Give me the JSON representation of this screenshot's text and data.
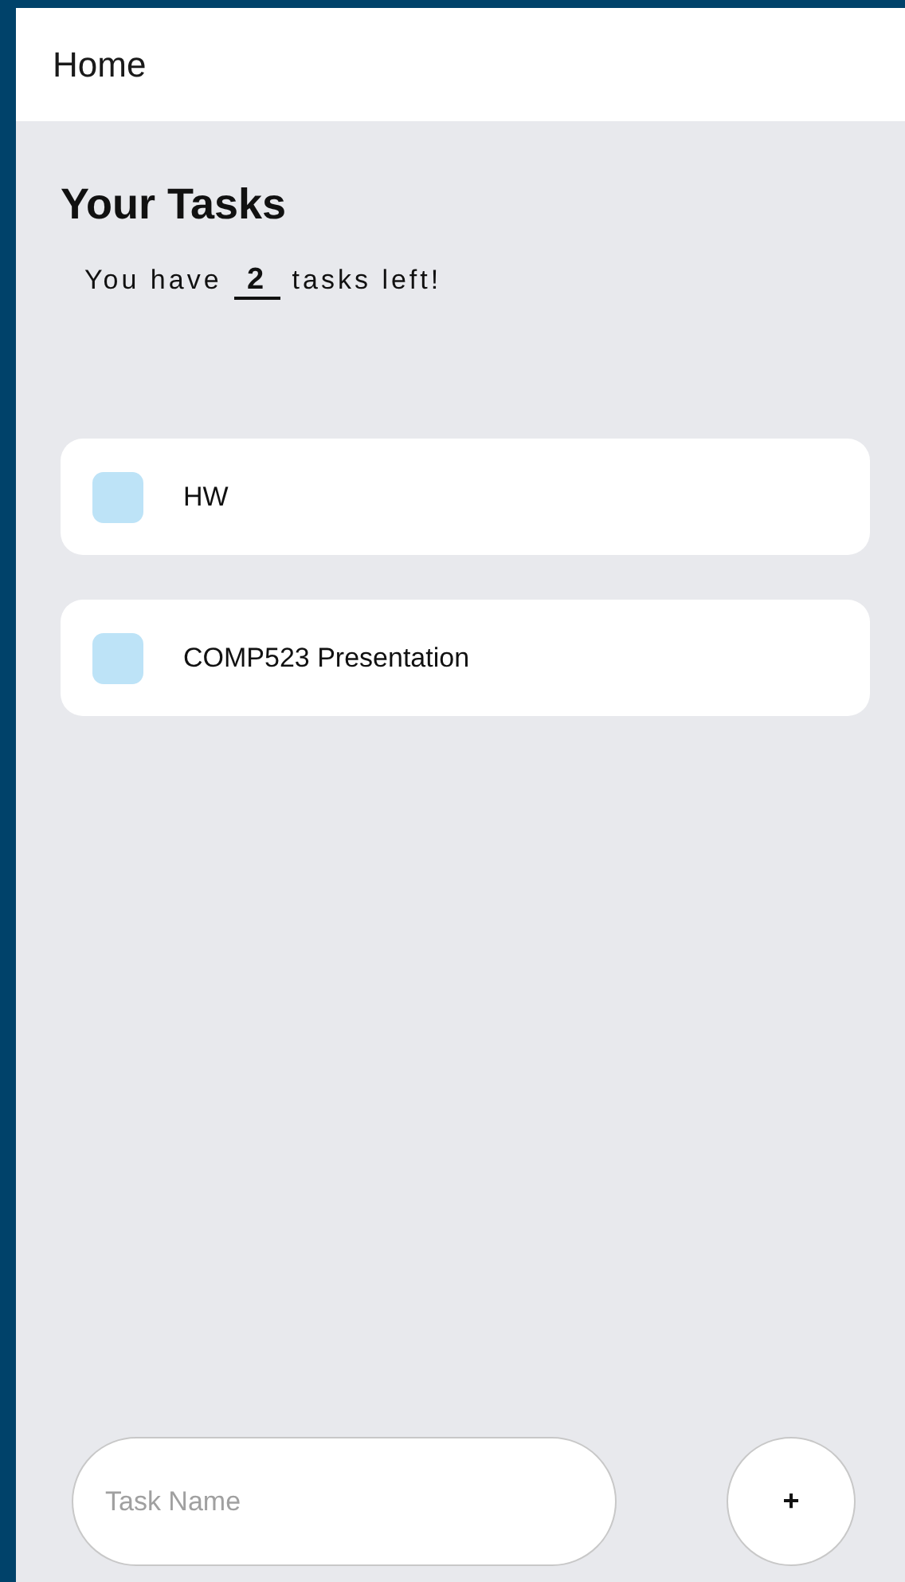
{
  "header": {
    "title": "Home"
  },
  "heading": "Your Tasks",
  "summary": "You have **2** tasks left!",
  "tasks": [
    {
      "label": "HW",
      "checked": false
    },
    {
      "label": "COMP523 Presentation",
      "checked": false
    }
  ],
  "new_task": {
    "placeholder": "Task Name",
    "button": "+"
  }
}
